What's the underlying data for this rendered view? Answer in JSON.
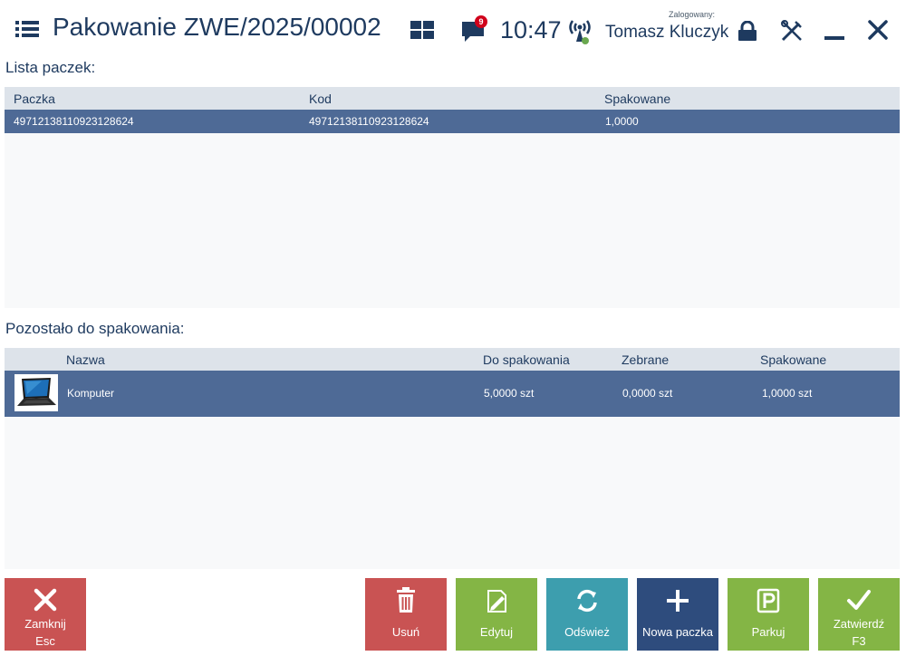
{
  "header": {
    "title": "Pakowanie ZWE/2025/00002",
    "notification_count": "9",
    "clock": "10:47",
    "logged_label": "Zalogowany:",
    "user_name": "Tomasz Kluczyk"
  },
  "packages": {
    "label": "Lista paczek:",
    "columns": [
      "Paczka",
      "Kod",
      "Spakowane"
    ],
    "rows": [
      {
        "package": "49712138110923128624",
        "code": "49712138110923128624",
        "packed": "1,0000"
      }
    ]
  },
  "remaining": {
    "label": "Pozostało do spakowania:",
    "columns": [
      "Nazwa",
      "Do spakowania",
      "Zebrane",
      "Spakowane"
    ],
    "rows": [
      {
        "name": "Komputer",
        "to_pack": "5,0000 szt",
        "collected": "0,0000 szt",
        "packed": "1,0000 szt"
      }
    ]
  },
  "buttons": {
    "close": {
      "label": "Zamknij",
      "shortcut": "Esc"
    },
    "delete": {
      "label": "Usuń"
    },
    "edit": {
      "label": "Edytuj"
    },
    "refresh": {
      "label": "Odśwież"
    },
    "new_package": {
      "label": "Nowa paczka"
    },
    "park": {
      "label": "Parkuj"
    },
    "confirm": {
      "label": "Zatwierdź",
      "shortcut": "F3"
    }
  },
  "colors": {
    "title": "#1e3a5f",
    "selected_row": "#4e6a96",
    "header_row": "#dde3ea",
    "red_button": "#c95353",
    "green_button": "#84b545",
    "teal_button": "#3d9eae",
    "navy_button": "#2e4c7d",
    "badge": "#d0021b"
  }
}
